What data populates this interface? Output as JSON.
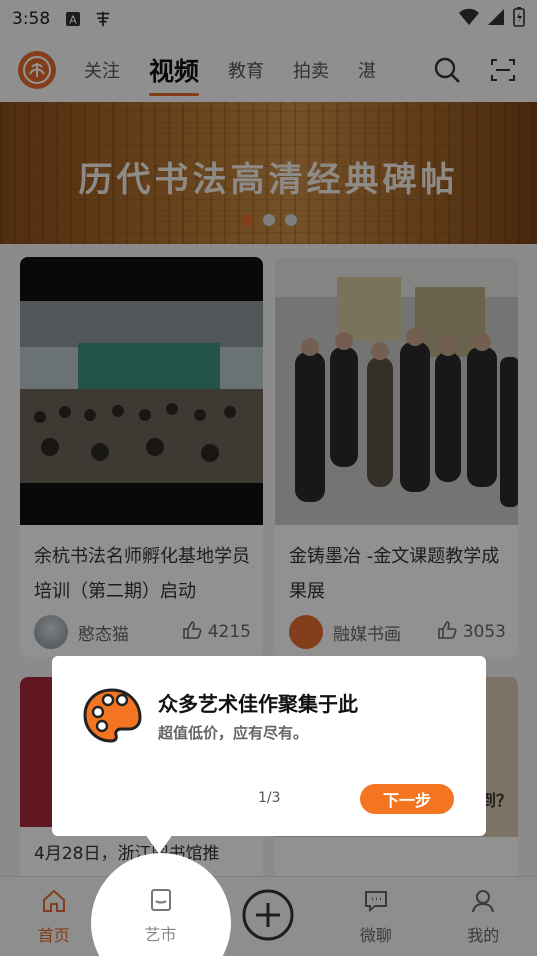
{
  "status_bar": {
    "time": "3:58"
  },
  "top_nav": {
    "tabs": [
      {
        "label": "关注"
      },
      {
        "label": "视频"
      },
      {
        "label": "教育"
      },
      {
        "label": "拍卖"
      },
      {
        "label": "湛"
      }
    ],
    "active_tab": "视频"
  },
  "banner": {
    "title": "历代书法高清经典碑帖",
    "dots": 3,
    "active_dot": 1
  },
  "cards": [
    {
      "title": "余杭书法名师孵化基地学员培训（第二期）启动",
      "author": "憨态猫",
      "likes": "4215"
    },
    {
      "title": "金铸墨冶 -金文课题教学成果展",
      "author": "融媒书画",
      "likes": "3053"
    },
    {
      "title": "4月28日，浙江图书馆推"
    },
    {
      "title": "到？"
    }
  ],
  "bottom_nav": {
    "items": [
      {
        "label": "首页",
        "icon": "home-icon"
      },
      {
        "label": "艺市",
        "icon": "market-icon"
      },
      {
        "label": "",
        "icon": "plus-circle-icon"
      },
      {
        "label": "微聊",
        "icon": "chat-icon"
      },
      {
        "label": "我的",
        "icon": "user-icon"
      }
    ],
    "active": "首页"
  },
  "guide_popup": {
    "title": "众多艺术佳作聚集于此",
    "subtitle": "超值低价，应有尽有。",
    "pager": "1/3",
    "next_label": "下一步"
  },
  "colors": {
    "accent": "#e36a2e",
    "next_button": "#f47521"
  }
}
